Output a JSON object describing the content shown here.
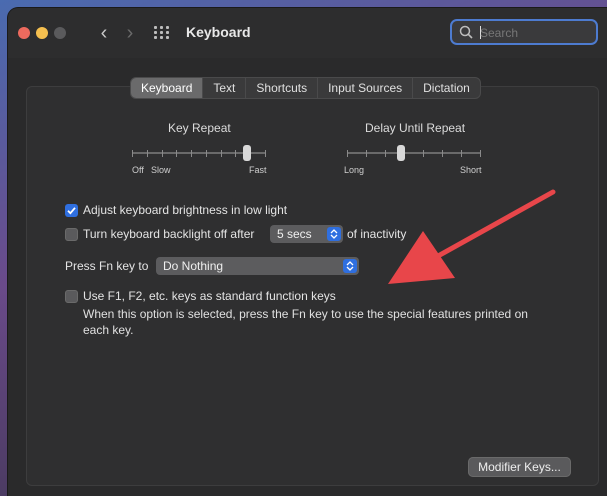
{
  "window": {
    "title": "Keyboard"
  },
  "search": {
    "placeholder": "Search"
  },
  "tabs": [
    {
      "label": "Keyboard",
      "active": true
    },
    {
      "label": "Text"
    },
    {
      "label": "Shortcuts"
    },
    {
      "label": "Input Sources"
    },
    {
      "label": "Dictation"
    }
  ],
  "key_repeat": {
    "title": "Key Repeat",
    "min_label": "Off",
    "slow_label": "Slow",
    "max_label": "Fast",
    "level": 0.86
  },
  "delay_repeat": {
    "title": "Delay Until Repeat",
    "min_label": "Long",
    "max_label": "Short",
    "level": 0.4
  },
  "options": {
    "brightness": {
      "label": "Adjust keyboard brightness in low light",
      "checked": true
    },
    "backlight": {
      "label": "Turn keyboard backlight off after",
      "checked": false,
      "value": "5 secs",
      "suffix": "of inactivity"
    },
    "fn_key": {
      "label": "Press Fn key to",
      "value": "Do Nothing"
    },
    "function_keys": {
      "label": "Use F1, F2, etc. keys as standard function keys",
      "checked": false,
      "description": "When this option is selected, press the Fn key to use the special features printed on each key."
    }
  },
  "modifier_button": {
    "label": "Modifier Keys..."
  },
  "colors": {
    "accent": "#2f6fe0",
    "annotation_arrow": "#e8464a"
  }
}
